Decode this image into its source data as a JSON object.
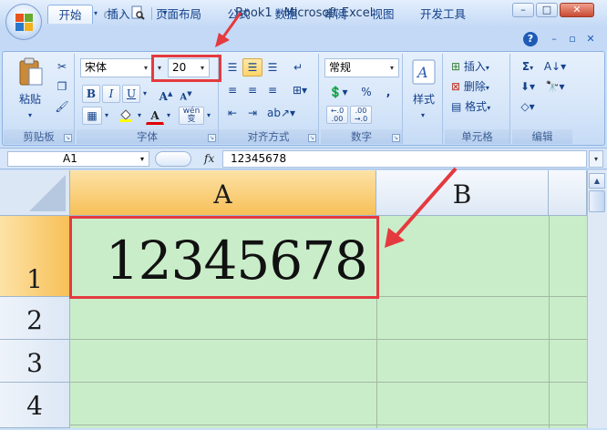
{
  "window": {
    "title": "Book1 - Microsoft Excel",
    "controls": {
      "minimize": "–",
      "maximize": "□",
      "close": "✕"
    }
  },
  "quick_access": [
    "save-icon",
    "undo-icon",
    "redo-icon",
    "print-preview-icon",
    "customize-dropdown-icon"
  ],
  "tabs": [
    {
      "label": "开始",
      "active": true
    },
    {
      "label": "插入",
      "active": false
    },
    {
      "label": "页面布局",
      "active": false
    },
    {
      "label": "公式",
      "active": false
    },
    {
      "label": "数据",
      "active": false
    },
    {
      "label": "审阅",
      "active": false
    },
    {
      "label": "视图",
      "active": false
    },
    {
      "label": "开发工具",
      "active": false
    }
  ],
  "ribbon": {
    "clipboard": {
      "group_label": "剪贴板",
      "paste_label": "粘贴"
    },
    "font": {
      "group_label": "字体",
      "font_name": "宋体",
      "font_size": "20",
      "bold": "B",
      "italic": "I",
      "underline": "U",
      "grow": "A",
      "shrink": "A",
      "phonetic": "wén 变",
      "font_color_letter": "A"
    },
    "alignment": {
      "group_label": "对齐方式"
    },
    "number": {
      "group_label": "数字",
      "format": "常规",
      "percent": "%",
      "comma": ",",
      "inc_decimal": "←.0 .00",
      "dec_decimal": ".00 →.0"
    },
    "styles": {
      "label": "样式"
    },
    "cells": {
      "group_label": "单元格",
      "insert": "插入",
      "delete": "删除",
      "format": "格式"
    },
    "editing": {
      "group_label": "编辑",
      "sum": "Σ"
    }
  },
  "formula_bar": {
    "name_box": "A1",
    "fx": "fx",
    "content": "12345678"
  },
  "sheet": {
    "columns": [
      "A",
      "B"
    ],
    "rows": [
      "1",
      "2",
      "3",
      "4"
    ],
    "cell_a1": "12345678",
    "selected_cell": "A1"
  },
  "colors": {
    "ribbon_bg": "#dbe8f8",
    "grid_bg": "#c9edc9",
    "selected_header": "#f7c058",
    "annotation_red": "#e43a3f"
  }
}
